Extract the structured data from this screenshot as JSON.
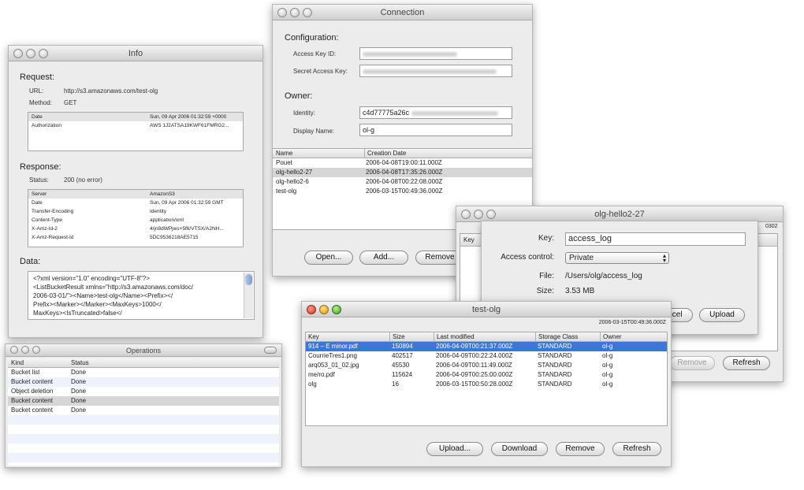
{
  "info": {
    "title": "Info",
    "request_heading": "Request:",
    "url_label": "URL:",
    "url_value": "http://s3.amazonaws.com/test-olg",
    "method_label": "Method:",
    "method_value": "GET",
    "req_headers": [
      {
        "k": "Date",
        "v": "Sun, 09 Apr 2006 01:32:59 +0000"
      },
      {
        "k": "Authorization",
        "v": "AWS 1J2ATSA19KWF61FMRG2..."
      }
    ],
    "response_heading": "Response:",
    "status_label": "Status:",
    "status_value": "200 (no error)",
    "resp_headers": [
      {
        "k": "Server",
        "v": "AmazonS3"
      },
      {
        "k": "Date",
        "v": "Sun, 09 Apr 2006 01:32:59 GMT"
      },
      {
        "k": "Transfer-Encoding",
        "v": "Identity"
      },
      {
        "k": "Content-Type",
        "v": "application/xml"
      },
      {
        "k": "X-Amz-Id-2",
        "v": "4/jn8dWPjws+5f6/VTSX/A2NH..."
      },
      {
        "k": "X-Amz-Request-Id",
        "v": "5DC9536218AE5715"
      }
    ],
    "data_heading": "Data:",
    "xml_lines": [
      "<?xml version=\"1.0\" encoding=\"UTF-8\"?>",
      "<ListBucketResult xmlns=\"http://s3.amazonaws.com/doc/",
      "2006-03-01/\"><Name>test-olg</Name><Prefix></",
      "Prefix><Marker></Marker><MaxKeys>1000</",
      "MaxKeys><IsTruncated>false</"
    ]
  },
  "operations": {
    "title": "Operations",
    "columns": [
      "Kind",
      "Status"
    ],
    "rows": [
      {
        "kind": "Bucket list",
        "status": "Done"
      },
      {
        "kind": "Bucket content",
        "status": "Done"
      },
      {
        "kind": "Object deletion",
        "status": "Done"
      },
      {
        "kind": "Bucket content",
        "status": "Done"
      },
      {
        "kind": "Bucket content",
        "status": "Done"
      }
    ]
  },
  "connection": {
    "title": "Connection",
    "configuration_heading": "Configuration:",
    "access_key_label": "Access Key ID:",
    "secret_key_label": "Secret Access Key:",
    "owner_heading": "Owner:",
    "identity_label": "Identity:",
    "identity_value": "c4d77775a26c",
    "display_name_label": "Display Name:",
    "display_name_value": "ol-g",
    "columns": [
      "Name",
      "Creation Date"
    ],
    "buckets": [
      {
        "name": "Pouet",
        "date": "2006-04-08T19:00:11.000Z"
      },
      {
        "name": "olg-hello2-27",
        "date": "2006-04-08T17:35:26.000Z"
      },
      {
        "name": "olg-hello2-6",
        "date": "2006-04-08T00:22:08.000Z"
      },
      {
        "name": "test-olg",
        "date": "2006-03-15T00:49:36.000Z"
      }
    ],
    "open_btn": "Open...",
    "add_btn": "Add...",
    "remove_btn": "Remove"
  },
  "hello": {
    "title": "olg-hello2-27",
    "key_col": "Key",
    "date_partial": "0302",
    "remove_btn": "Remove",
    "refresh_btn": "Refresh"
  },
  "upload_sheet": {
    "key_label": "Key:",
    "key_value": "access_log",
    "access_label": "Access control:",
    "access_value": "Private",
    "file_label": "File:",
    "file_value": "/Users/olg/access_log",
    "size_label": "Size:",
    "size_value": "3.53 MB",
    "cancel_btn": "Cancel",
    "upload_btn": "Upload"
  },
  "testolg": {
    "title": "test-olg",
    "created": "2006-03-15T00:49:36.000Z",
    "columns": [
      "Key",
      "Size",
      "Last modified",
      "Storage Class",
      "Owner"
    ],
    "rows": [
      {
        "key": "914 – E minor.pdf",
        "size": "150894",
        "modified": "2006-04-09T00:21:37.000Z",
        "storage": "STANDARD",
        "owner": "ol-g"
      },
      {
        "key": "CourrieTres1.png",
        "size": "402517",
        "modified": "2006-04-09T00:22:24.000Z",
        "storage": "STANDARD",
        "owner": "ol-g"
      },
      {
        "key": "arq053_01_02.jpg",
        "size": "45530",
        "modified": "2006-04-09T00:11:49.000Z",
        "storage": "STANDARD",
        "owner": "ol-g"
      },
      {
        "key": "me/ro.pdf",
        "size": "115624",
        "modified": "2006-04-09T00:25:00.000Z",
        "storage": "STANDARD",
        "owner": "ol-g"
      },
      {
        "key": "olg",
        "size": "16",
        "modified": "2006-03-15T00:50:28.000Z",
        "storage": "STANDARD",
        "owner": "ol-g"
      }
    ],
    "upload_btn": "Upload...",
    "download_btn": "Download",
    "remove_btn": "Remove",
    "refresh_btn": "Refresh"
  },
  "colors": {
    "selection_blue": "#3c77d6",
    "selection_gray": "#d6d6d6",
    "row_alt": "#eef3fb"
  }
}
